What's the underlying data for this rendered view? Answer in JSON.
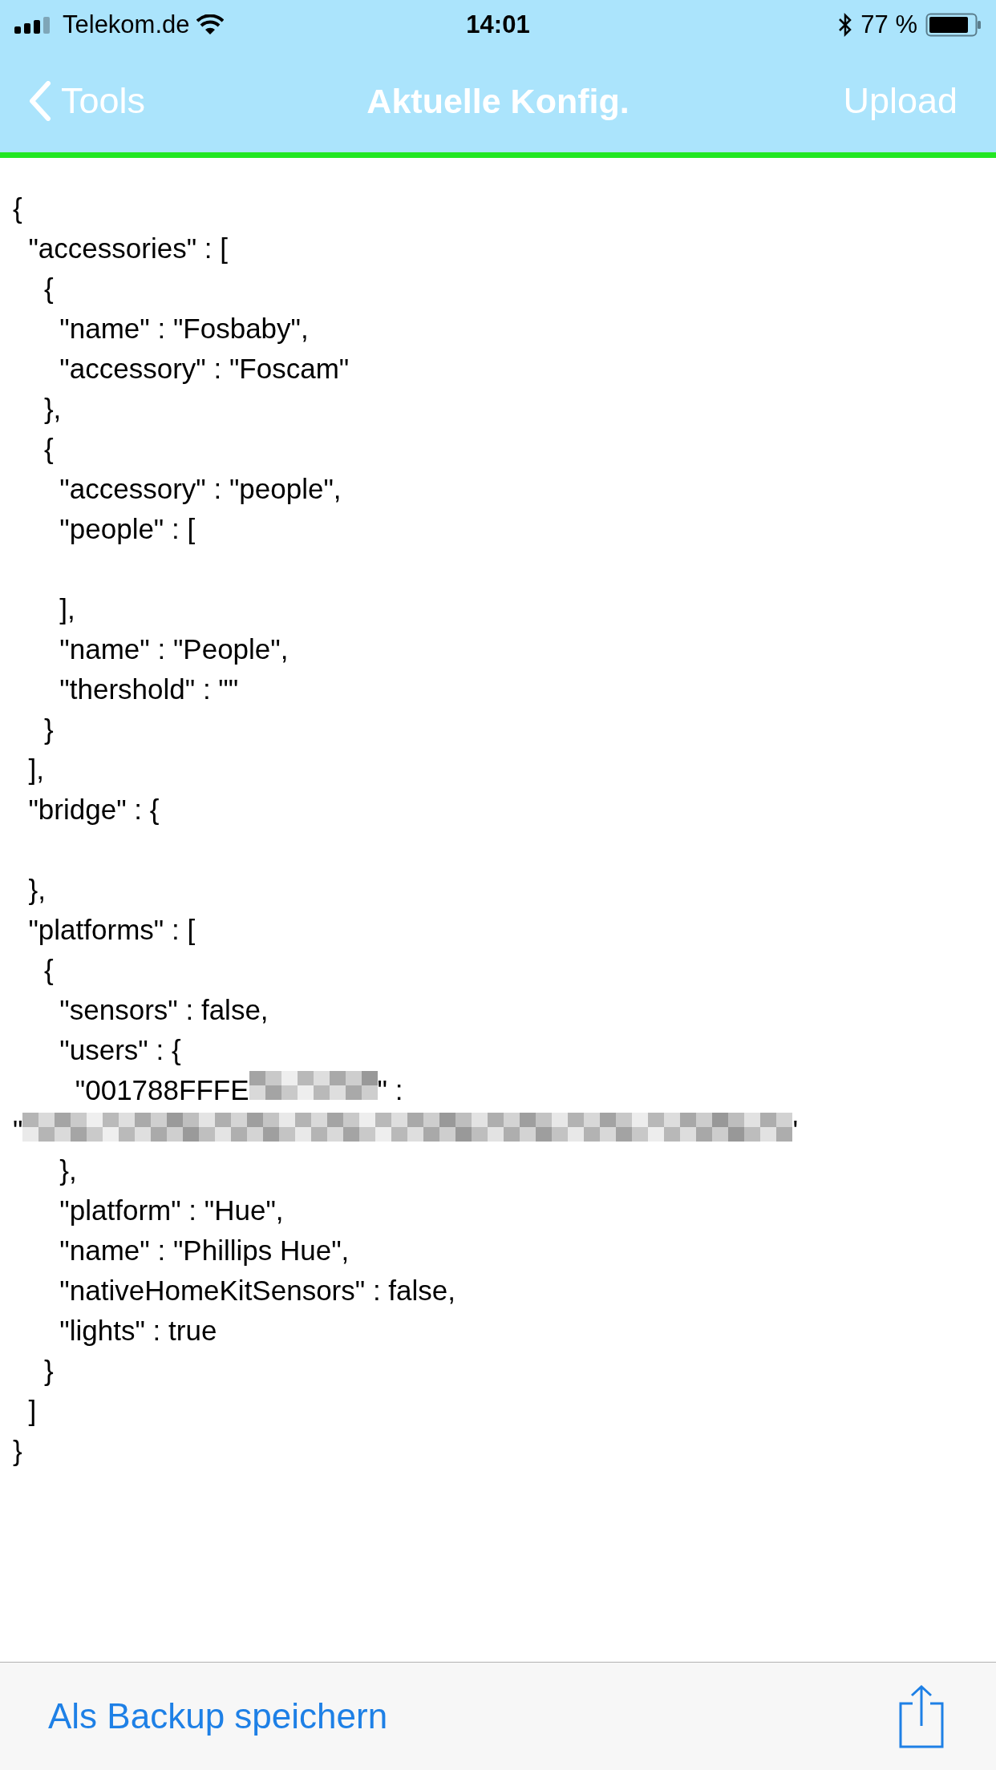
{
  "status_bar": {
    "carrier": "Telekom.de",
    "time": "14:01",
    "battery": "77 %"
  },
  "nav_bar": {
    "back": "Tools",
    "title": "Aktuelle Konfig.",
    "action": "Upload"
  },
  "code_lines": [
    {
      "kind": "text",
      "text": "{"
    },
    {
      "kind": "text",
      "text": "  \"accessories\" : ["
    },
    {
      "kind": "text",
      "text": "    {"
    },
    {
      "kind": "text",
      "text": "      \"name\" : \"Fosbaby\","
    },
    {
      "kind": "text",
      "text": "      \"accessory\" : \"Foscam\""
    },
    {
      "kind": "text",
      "text": "    },"
    },
    {
      "kind": "text",
      "text": "    {"
    },
    {
      "kind": "text",
      "text": "      \"accessory\" : \"people\","
    },
    {
      "kind": "text",
      "text": "      \"people\" : ["
    },
    {
      "kind": "blank"
    },
    {
      "kind": "text",
      "text": "      ],"
    },
    {
      "kind": "text",
      "text": "      \"name\" : \"People\","
    },
    {
      "kind": "text",
      "text": "      \"thershold\" : \"\""
    },
    {
      "kind": "text",
      "text": "    }"
    },
    {
      "kind": "text",
      "text": "  ],"
    },
    {
      "kind": "text",
      "text": "  \"bridge\" : {"
    },
    {
      "kind": "blank"
    },
    {
      "kind": "text",
      "text": "  },"
    },
    {
      "kind": "text",
      "text": "  \"platforms\" : ["
    },
    {
      "kind": "text",
      "text": "    {"
    },
    {
      "kind": "text",
      "text": "      \"sensors\" : false,"
    },
    {
      "kind": "text",
      "text": "      \"users\" : {"
    },
    {
      "kind": "redacted",
      "before": "        \"001788FFFE",
      "after": "\" :"
    },
    {
      "kind": "redacted",
      "before": "\"",
      "after": "'"
    },
    {
      "kind": "text",
      "text": "      },"
    },
    {
      "kind": "text",
      "text": "      \"platform\" : \"Hue\","
    },
    {
      "kind": "text",
      "text": "      \"name\" : \"Phillips Hue\","
    },
    {
      "kind": "text",
      "text": "      \"nativeHomeKitSensors\" : false,"
    },
    {
      "kind": "text",
      "text": "      \"lights\" : true"
    },
    {
      "kind": "text",
      "text": "    }"
    },
    {
      "kind": "text",
      "text": "  ]"
    },
    {
      "kind": "text",
      "text": "}"
    }
  ],
  "toolbar": {
    "backup": "Als Backup speichern"
  }
}
